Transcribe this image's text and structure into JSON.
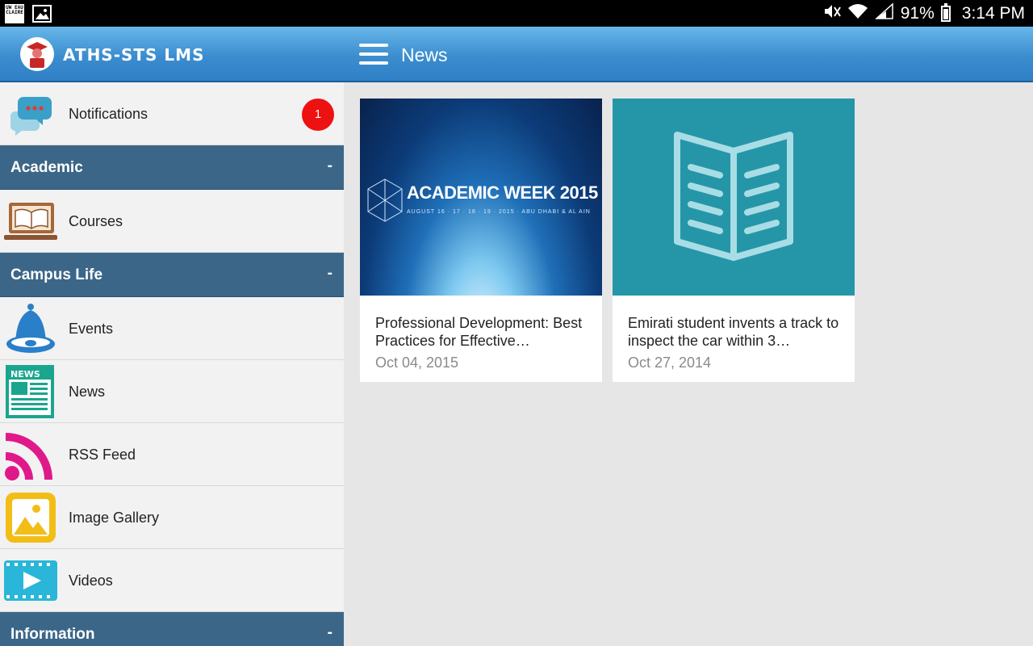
{
  "status_bar": {
    "left_icons": [
      "uw-eau-claire-logo-icon",
      "image-notification-icon"
    ],
    "uw_logo_text": "UW EAU CLAIRE",
    "battery": "91%",
    "time": "3:14 PM",
    "right_icons": [
      "mute-icon",
      "wifi-icon",
      "signal-icon",
      "battery-icon"
    ]
  },
  "app_bar": {
    "app_title": "ATHS-STS LMS",
    "page_title": "News",
    "colors": {
      "bar": "#3b8dcf",
      "section": "#3b6688",
      "badge": "#ee1111"
    }
  },
  "sidebar": {
    "notifications": {
      "label": "Notifications",
      "badge": "1",
      "icon": "chat-bubbles-icon"
    },
    "sections": [
      {
        "title": "Academic",
        "toggle": "-",
        "items": [
          {
            "label": "Courses",
            "icon": "laptop-book-icon"
          }
        ]
      },
      {
        "title": "Campus Life",
        "toggle": "-",
        "items": [
          {
            "label": "Events",
            "icon": "bell-icon"
          },
          {
            "label": "News",
            "icon": "newspaper-icon"
          },
          {
            "label": "RSS Feed",
            "icon": "rss-icon"
          },
          {
            "label": "Image Gallery",
            "icon": "image-gallery-icon"
          },
          {
            "label": "Videos",
            "icon": "video-icon"
          }
        ]
      },
      {
        "title": "Information",
        "toggle": "-",
        "items": []
      }
    ]
  },
  "news": [
    {
      "title": "Professional Development: Best Practices for Effective…",
      "date": "Oct 04, 2015",
      "image_text": "ACADEMIC WEEK 2015",
      "image_subtext": "AUGUST 16 · 17 · 18 · 19 · 2015 · ABU DHABI & AL AIN"
    },
    {
      "title": "Emirati student invents a track to inspect the car within 3…",
      "date": "Oct 27, 2014",
      "image_icon": "open-book-icon"
    }
  ]
}
